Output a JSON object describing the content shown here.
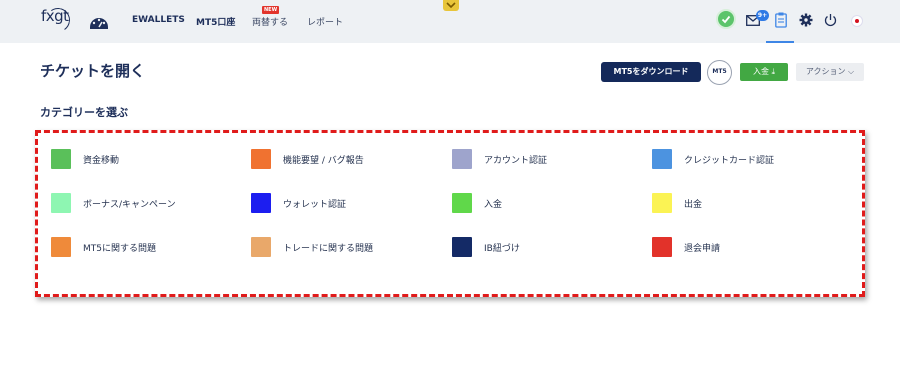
{
  "header": {
    "logo_text": "fxgt",
    "nav": [
      {
        "label": "EWALLETS",
        "style": "bold"
      },
      {
        "label": "MT5口座",
        "style": "bold"
      },
      {
        "label": "両替する",
        "style": "light"
      },
      {
        "label": "レポート",
        "style": "light"
      }
    ],
    "new_badge": "NEW",
    "notification_count": "9+"
  },
  "page": {
    "title": "チケットを開く",
    "download_button": "MT5をダウンロード",
    "mt5_badge": "MT5",
    "deposit_button": "入金 ⤓",
    "action_button": "アクション ⌵",
    "section_title": "カテゴリーを選ぶ"
  },
  "categories": [
    {
      "label": "資金移動",
      "color": "#5ac05a"
    },
    {
      "label": "機能要望 / バグ報告",
      "color": "#f07230"
    },
    {
      "label": "アカウント認証",
      "color": "#9ea4cc"
    },
    {
      "label": "クレジットカード認証",
      "color": "#4c93e0"
    },
    {
      "label": "ボーナス/キャンペーン",
      "color": "#8ef6b2"
    },
    {
      "label": "ウォレット認証",
      "color": "#1c1ef0"
    },
    {
      "label": "入金",
      "color": "#60d84a"
    },
    {
      "label": "出金",
      "color": "#fbf354"
    },
    {
      "label": "MT5に関する問題",
      "color": "#ef8a3a"
    },
    {
      "label": "トレードに関する問題",
      "color": "#e9a86a"
    },
    {
      "label": "IB紐づけ",
      "color": "#142a66"
    },
    {
      "label": "退会申請",
      "color": "#e2322a"
    }
  ],
  "accent_colors": {
    "primary_navy": "#14295a",
    "deposit_green": "#42a843",
    "highlight_red": "#e01b1b"
  }
}
